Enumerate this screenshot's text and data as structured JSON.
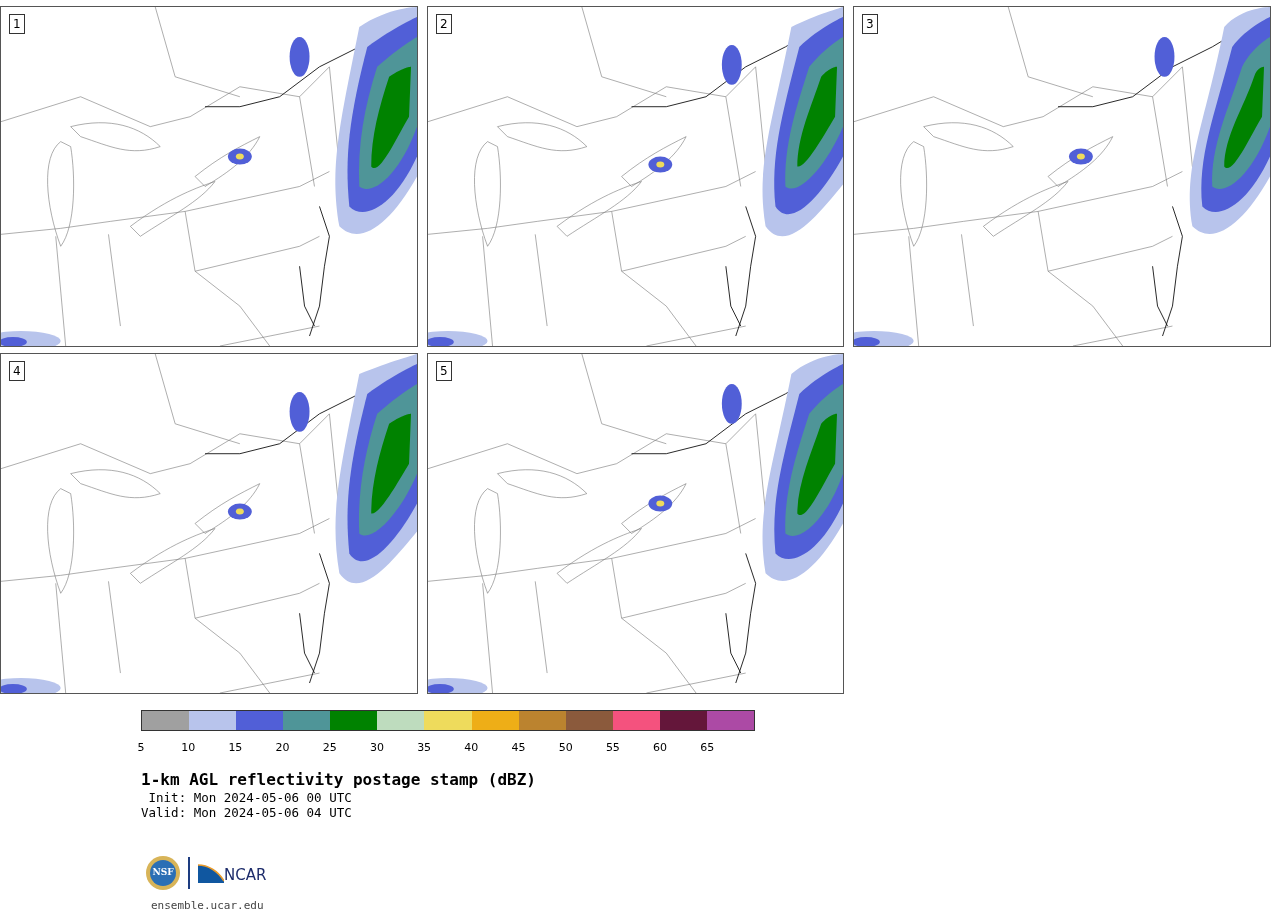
{
  "panels": [
    {
      "label": "1"
    },
    {
      "label": "2"
    },
    {
      "label": "3"
    },
    {
      "label": "4"
    },
    {
      "label": "5"
    }
  ],
  "colorbar": {
    "segments": [
      {
        "color": "#a0a0a0"
      },
      {
        "color": "#b8c4ec"
      },
      {
        "color": "#515fd7"
      },
      {
        "color": "#4f9598"
      },
      {
        "color": "#008200"
      },
      {
        "color": "#bedcbe"
      },
      {
        "color": "#eedb5c"
      },
      {
        "color": "#eeae17"
      },
      {
        "color": "#bb832f"
      },
      {
        "color": "#8b5a3c"
      },
      {
        "color": "#f4527e"
      },
      {
        "color": "#64163a"
      },
      {
        "color": "#ac4aa5"
      }
    ],
    "ticks": [
      "5",
      "10",
      "15",
      "20",
      "25",
      "30",
      "35",
      "40",
      "45",
      "50",
      "55",
      "60",
      "65"
    ]
  },
  "title": "1-km AGL reflectivity postage stamp (dBZ)",
  "init": " Init: Mon 2024-05-06 00 UTC",
  "valid": "Valid: Mon 2024-05-06 04 UTC",
  "logo": {
    "left": "NSF",
    "right": "NCAR"
  },
  "url": "ensemble.ucar.edu"
}
